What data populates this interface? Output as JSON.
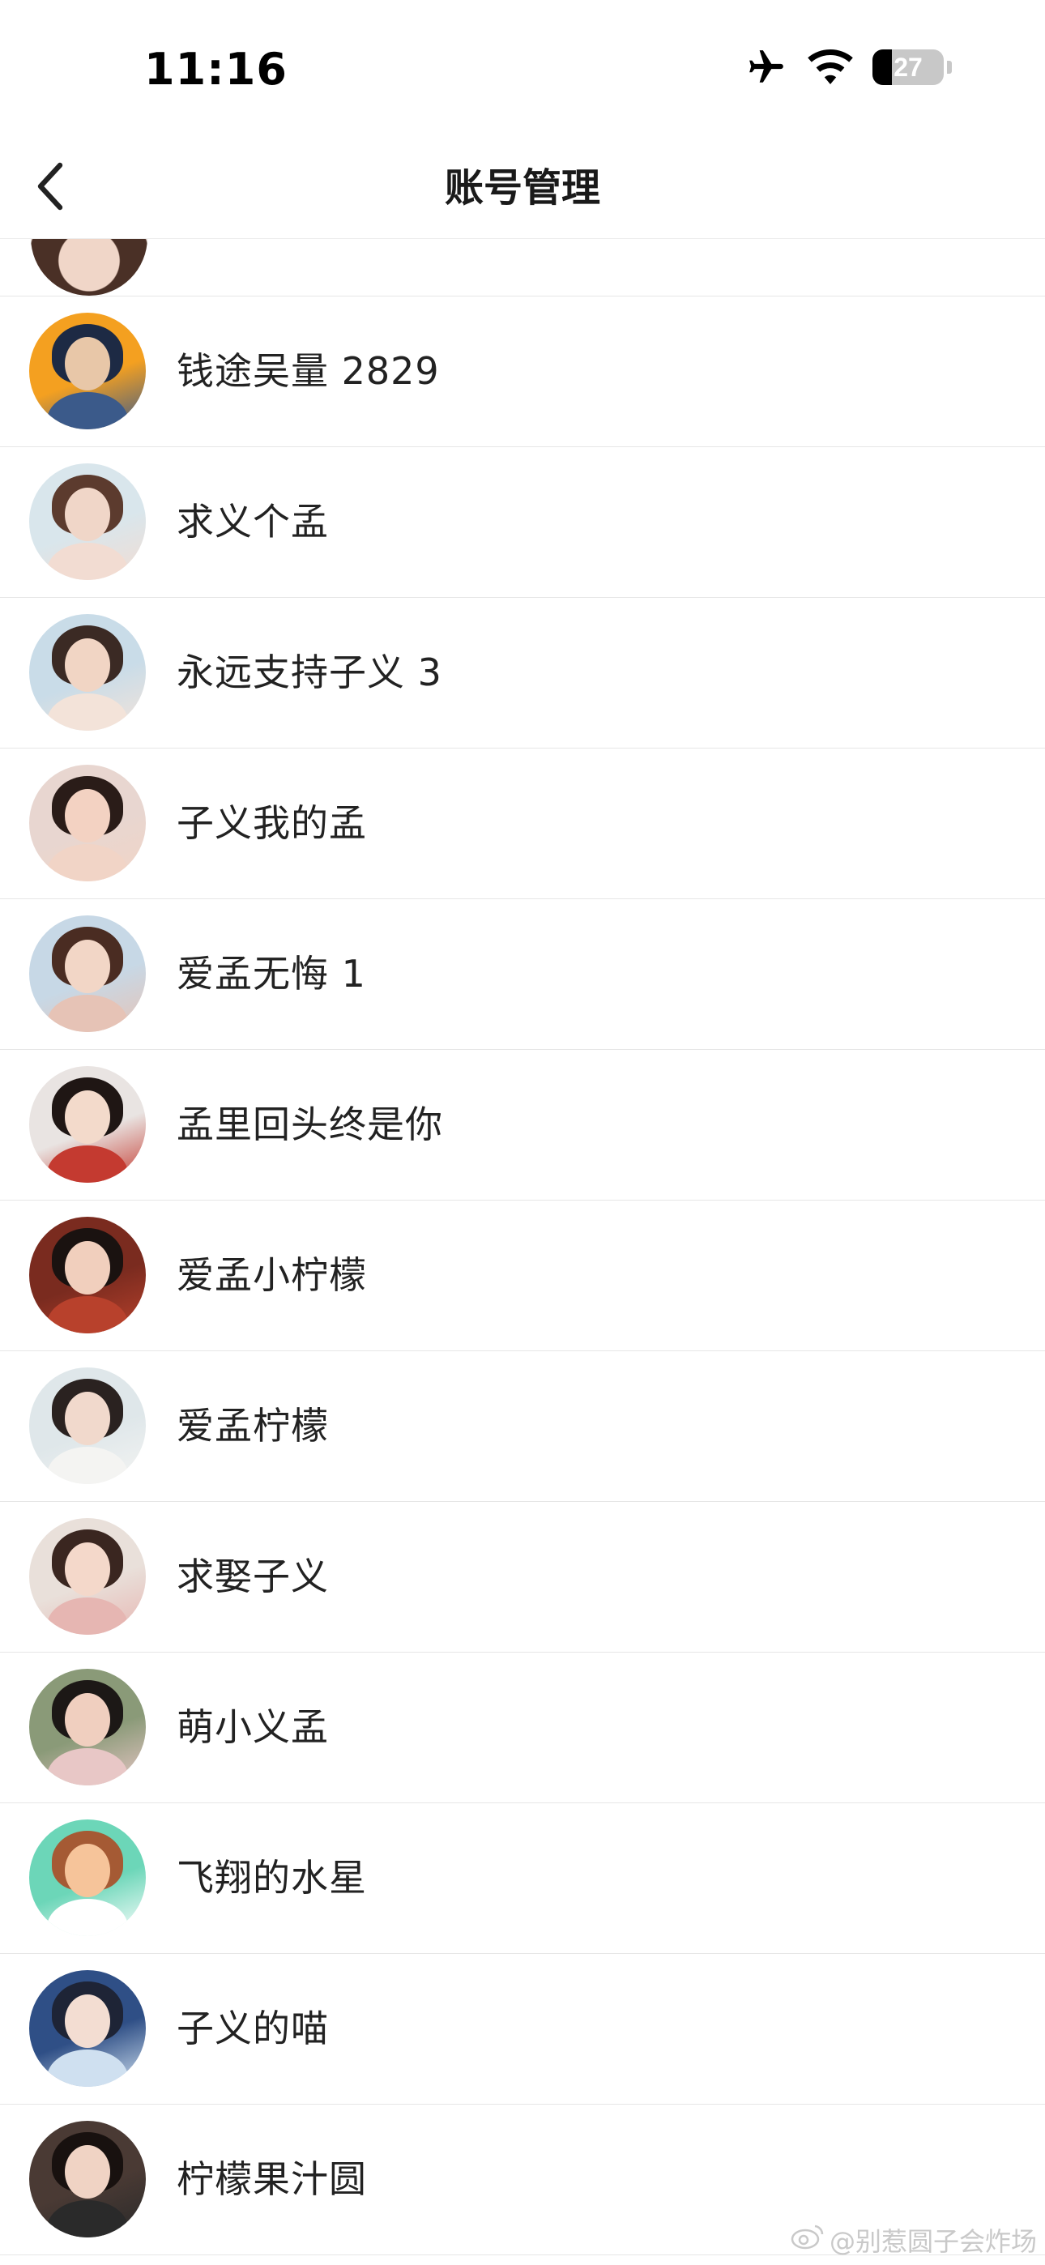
{
  "status_bar": {
    "time": "11:16",
    "battery_level": "27",
    "battery_percent": 27,
    "icons": [
      "airplane-icon",
      "wifi-icon",
      "battery-icon"
    ]
  },
  "nav": {
    "title": "账号管理",
    "back_icon": "chevron-left-icon"
  },
  "accounts": [
    {
      "name": "钱途吴量 2829",
      "avatar_colors": [
        "#f4a020",
        "#3b5a8a",
        "#e8c7a8",
        "#1d2a44"
      ]
    },
    {
      "name": "求义个孟",
      "avatar_colors": [
        "#d9e6ec",
        "#f2dcd2",
        "#f0d6c8",
        "#5c3b2e"
      ]
    },
    {
      "name": "永远支持子义 3",
      "avatar_colors": [
        "#c9dce8",
        "#f3e3d9",
        "#f1d5c4",
        "#3b2a24"
      ]
    },
    {
      "name": "子义我的孟",
      "avatar_colors": [
        "#e8d6d0",
        "#f1d4c6",
        "#f3d2c2",
        "#2a1c18"
      ]
    },
    {
      "name": "爱孟无悔 1",
      "avatar_colors": [
        "#c7d8e6",
        "#e6c3b6",
        "#f2d6c6",
        "#4a2c22"
      ]
    },
    {
      "name": "孟里回头终是你",
      "avatar_colors": [
        "#e9e4e2",
        "#c43a30",
        "#f3dacb",
        "#1f1614"
      ]
    },
    {
      "name": "爱孟小柠檬",
      "avatar_colors": [
        "#7a2b1f",
        "#b8412c",
        "#f1cfbd",
        "#1a1210"
      ]
    },
    {
      "name": "爱孟柠檬",
      "avatar_colors": [
        "#dfe7ea",
        "#f4f4f2",
        "#f1d9cc",
        "#2a2220"
      ]
    },
    {
      "name": "求娶子义",
      "avatar_colors": [
        "#e9e0da",
        "#e6b6b2",
        "#f4d8ca",
        "#3a2620"
      ]
    },
    {
      "name": "萌小义孟",
      "avatar_colors": [
        "#8a9a78",
        "#e8c7c6",
        "#f0cfbf",
        "#1c1816"
      ]
    },
    {
      "name": "飞翔的水星",
      "avatar_colors": [
        "#6cd6b8",
        "#ffffff",
        "#f6c49a",
        "#a55a34"
      ]
    },
    {
      "name": "子义的喵",
      "avatar_colors": [
        "#2f4f86",
        "#cfe0f0",
        "#f3ddd2",
        "#1e2436"
      ]
    },
    {
      "name": "柠檬果汁圆",
      "avatar_colors": [
        "#4a3a34",
        "#2a2a2a",
        "#f0d3c4",
        "#18110f"
      ]
    }
  ],
  "watermark": "@别惹圆子会炸场"
}
